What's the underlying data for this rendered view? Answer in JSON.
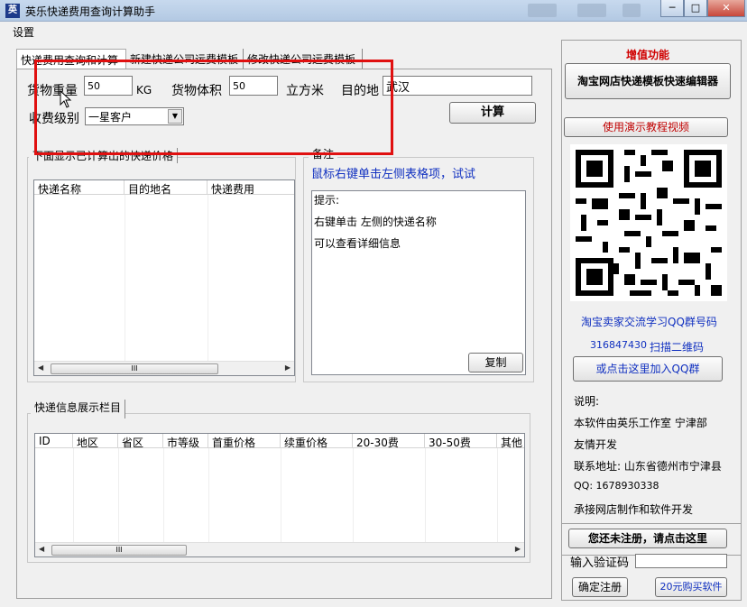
{
  "window": {
    "title": "英乐快递费用查询计算助手",
    "icon": "app-icon",
    "min_label": "─",
    "max_label": "□",
    "close_label": "✕"
  },
  "menu": {
    "settings": "设置"
  },
  "tabs": [
    {
      "label": "快递费用查询和计算",
      "active": true
    },
    {
      "label": "新建快递公司运费模板",
      "active": false
    },
    {
      "label": "修改快递公司运费模板",
      "active": false
    }
  ],
  "form": {
    "weight_label": "货物重量",
    "weight_value": "50",
    "weight_unit": "KG",
    "volume_label": "货物体积",
    "volume_value": "50",
    "volume_unit": "立方米",
    "dest_label": "目的地",
    "dest_value": "武汉",
    "level_label": "收费级别",
    "level_value": "一星客户",
    "calc_button": "计算"
  },
  "results": {
    "group_title": "下面显示已计算出的快递价格",
    "columns": [
      "快递名称",
      "目的地名",
      "快递费用"
    ]
  },
  "notes": {
    "group_title": "备注",
    "hint": "鼠标右键单击左侧表格项，试试",
    "lines": [
      "提示:",
      "右键单击   左侧的快递名称",
      "可以查看详细信息"
    ],
    "copy_button": "复制"
  },
  "info": {
    "group_title": "快递信息展示栏目",
    "columns": [
      "ID",
      "地区",
      "省区",
      "市等级",
      "首重价格",
      "续重价格",
      "20-30费",
      "30-50费",
      "其他"
    ]
  },
  "side": {
    "addon_title": "增值功能",
    "editor_button": "淘宝网店快递模板快速编辑器",
    "video_button": "使用演示教程视频",
    "qq_group_title": "淘宝卖家交流学习QQ群号码",
    "qq_group_number": "316847430",
    "scan_text": "扫描二维码",
    "join_button": "或点击这里加入QQ群",
    "desc_title": "说明:",
    "desc_lines": [
      "本软件由英乐工作室 宁津部",
      "友情开发",
      "联系地址: 山东省德州市宁津县",
      "QQ: 1678930338",
      "承接网店制作和软件开发"
    ],
    "register_button": "您还未注册，请点击这里",
    "code_label": "输入验证码",
    "confirm_button": "确定注册",
    "buy_button": "20元购买软件"
  },
  "scroll_thumb": "III",
  "colors": {
    "highlight": "#e01010",
    "link_blue": "#1030c0",
    "accent_red": "#d00000"
  }
}
